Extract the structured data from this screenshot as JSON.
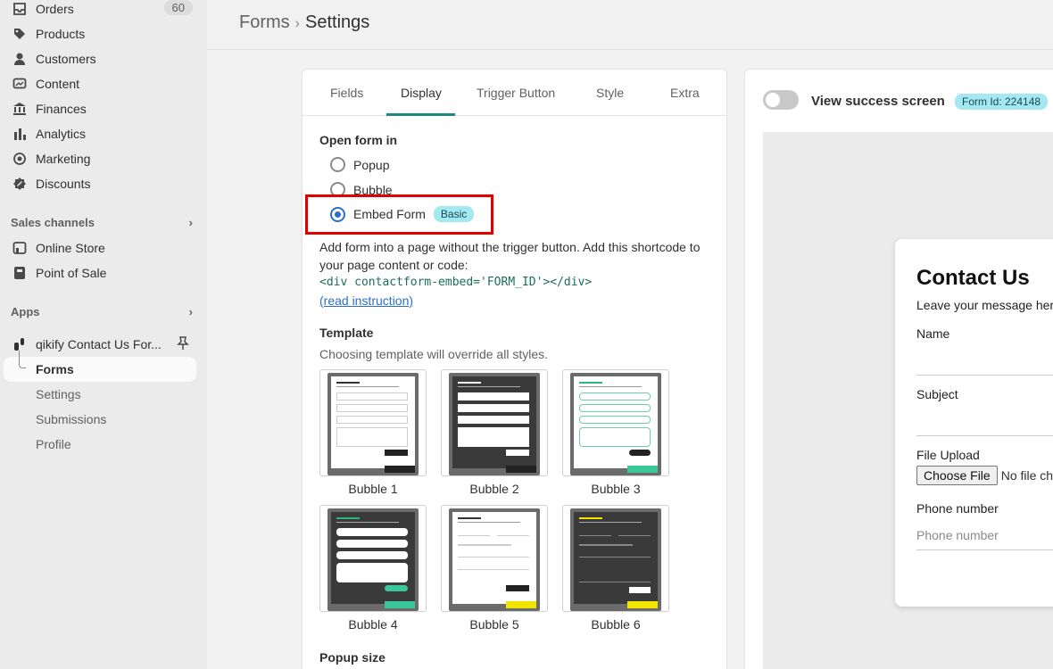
{
  "sidebar": {
    "items": [
      {
        "label": "Orders",
        "icon": "orders-icon",
        "count": "60"
      },
      {
        "label": "Products",
        "icon": "tag-icon"
      },
      {
        "label": "Customers",
        "icon": "person-icon"
      },
      {
        "label": "Content",
        "icon": "content-icon"
      },
      {
        "label": "Finances",
        "icon": "bank-icon"
      },
      {
        "label": "Analytics",
        "icon": "bar-chart-icon"
      },
      {
        "label": "Marketing",
        "icon": "target-icon"
      },
      {
        "label": "Discounts",
        "icon": "discount-icon"
      }
    ],
    "sales_channels": {
      "title": "Sales channels",
      "items": [
        {
          "label": "Online Store",
          "icon": "store-icon"
        },
        {
          "label": "Point of Sale",
          "icon": "pos-icon"
        }
      ]
    },
    "apps": {
      "title": "Apps",
      "app_name": "qikify Contact Us For...",
      "subitems": [
        "Forms",
        "Settings",
        "Submissions",
        "Profile"
      ]
    }
  },
  "header": {
    "crumb_parent": "Forms",
    "crumb_current": "Settings"
  },
  "settings": {
    "tabs": [
      "Fields",
      "Display",
      "Trigger Button",
      "Style",
      "Extra"
    ],
    "active_tab": "Display",
    "open_form_in": {
      "title": "Open form in",
      "options": [
        "Popup",
        "Bubble",
        "Embed Form"
      ],
      "selected": "Embed Form",
      "badge": "Basic"
    },
    "embed_description": "Add form into a page without the trigger button. Add this shortcode to your page content or code:",
    "shortcode": "<div contactform-embed='FORM_ID'></div>",
    "read_instruction": "(read instruction)",
    "template": {
      "title": "Template",
      "help": "Choosing template will override all styles.",
      "items": [
        "Bubble 1",
        "Bubble 2",
        "Bubble 3",
        "Bubble 4",
        "Bubble 5",
        "Bubble 6"
      ]
    },
    "popup_size_title": "Popup size"
  },
  "preview": {
    "toggle_label": "View success screen",
    "toggle_on": false,
    "form_id": "Form Id: 224148",
    "form": {
      "title": "Contact Us",
      "subtitle": "Leave your message here and",
      "fields": [
        "Name",
        "Subject",
        "File Upload",
        "Phone number"
      ],
      "file_button": "Choose File",
      "file_status": "No file chosen",
      "phone_placeholder": "Phone number"
    }
  },
  "colors": {
    "accent": "#1b8a7d",
    "radio": "#2c6ecb",
    "badge": "#a4e8f2",
    "highlight": "#e00000"
  }
}
